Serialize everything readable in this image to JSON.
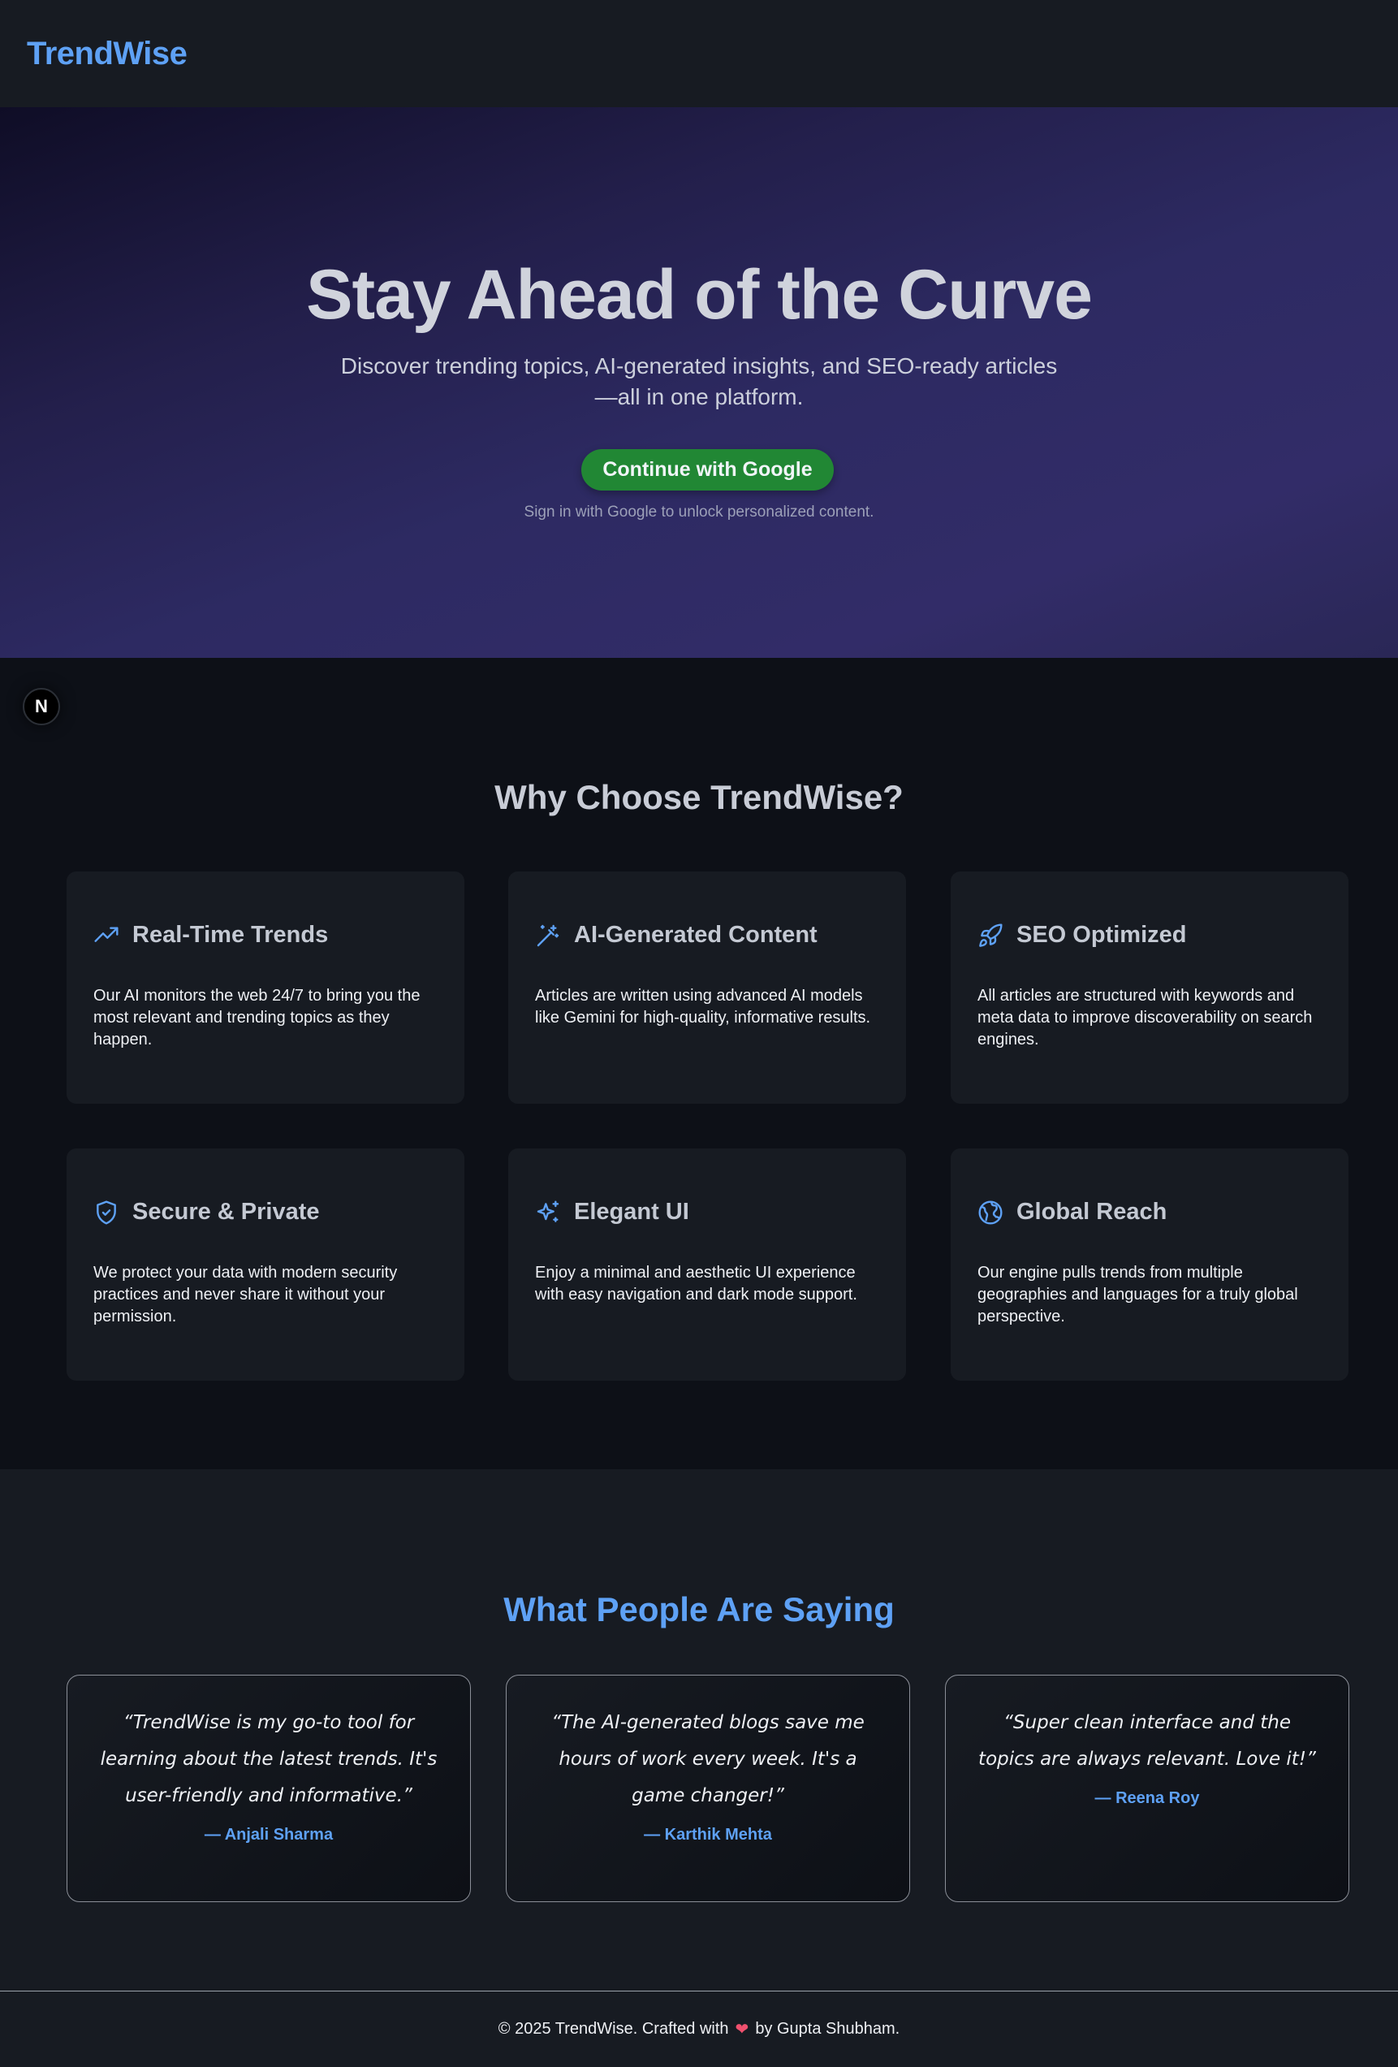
{
  "header": {
    "brand": "TrendWise"
  },
  "hero": {
    "title": "Stay Ahead of the Curve",
    "subtitle": "Discover trending topics, AI-generated insights, and SEO-ready articles—all in one platform.",
    "cta_label": "Continue with Google",
    "hint": "Sign in with Google to unlock personalized content."
  },
  "dev_badge": {
    "label": "N"
  },
  "features": {
    "title": "Why Choose TrendWise?",
    "items": [
      {
        "icon": "trending-up-icon",
        "title": "Real-Time Trends",
        "desc": "Our AI monitors the web 24/7 to bring you the most relevant and trending topics as they happen."
      },
      {
        "icon": "magic-wand-icon",
        "title": "AI-Generated Content",
        "desc": "Articles are written using advanced AI models like Gemini for high-quality, informative results."
      },
      {
        "icon": "rocket-icon",
        "title": "SEO Optimized",
        "desc": "All articles are structured with keywords and meta data to improve discoverability on search engines."
      },
      {
        "icon": "shield-check-icon",
        "title": "Secure & Private",
        "desc": "We protect your data with modern security practices and never share it without your permission."
      },
      {
        "icon": "sparkles-icon",
        "title": "Elegant UI",
        "desc": "Enjoy a minimal and aesthetic UI experience with easy navigation and dark mode support."
      },
      {
        "icon": "globe-icon",
        "title": "Global Reach",
        "desc": "Our engine pulls trends from multiple geographies and languages for a truly global perspective."
      }
    ]
  },
  "testimonials": {
    "title": "What People Are Saying",
    "items": [
      {
        "quote": "“TrendWise is my go-to tool for learning about the latest trends. It's user-friendly and informative.”",
        "author": "— Anjali Sharma"
      },
      {
        "quote": "“The AI-generated blogs save me hours of work every week. It's a game changer!”",
        "author": "— Karthik Mehta"
      },
      {
        "quote": "“Super clean interface and the topics are always relevant. Love it!”",
        "author": "— Reena Roy"
      }
    ]
  },
  "footer": {
    "prefix": "© 2025 TrendWise. Crafted with",
    "heart": "❤",
    "suffix": "by Gupta Shubham."
  },
  "colors": {
    "accent": "#5ea1f5",
    "cta": "#218734",
    "heart": "#f0506e"
  }
}
